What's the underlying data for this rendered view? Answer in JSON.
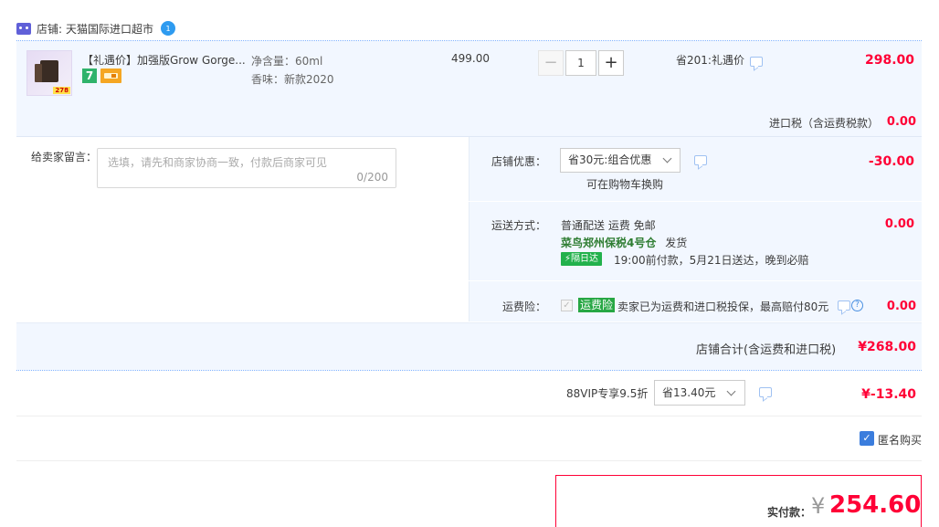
{
  "shop": {
    "label": "店铺:",
    "name": "天猫国际进口超市",
    "badge": "1"
  },
  "item": {
    "title": "【礼遇价】加强版Grow Gorge...",
    "thumb_price": "278",
    "sku": [
      {
        "label": "净含量：",
        "value": "60ml"
      },
      {
        "label": "香味：",
        "value": "新款2020"
      }
    ],
    "unit_price": "499.00",
    "quantity": "1",
    "promo": "省201:礼遇价",
    "subtotal": "298.00",
    "badge_7": "7"
  },
  "tax": {
    "label": "进口税（含运费税款）",
    "value": "0.00"
  },
  "message": {
    "label": "给卖家留言：",
    "placeholder": "选填，请先和商家协商一致，付款后商家可见",
    "counter": "0/200"
  },
  "discount": {
    "label": "店铺优惠：",
    "selected": "省30元:组合优惠",
    "hint": "可在购物车换购",
    "value": "-30.00"
  },
  "shipping": {
    "label": "运送方式：",
    "method": "普通配送 运费 免邮",
    "warehouse": "菜鸟郑州保税4号仓",
    "ship_word": "发货",
    "next_day": "隔日达",
    "eta": "19:00前付款，5月21日送达，晚到必赔",
    "value": "0.00"
  },
  "insurance": {
    "label": "运费险：",
    "tag": "运费险",
    "desc": "卖家已为运费和进口税投保，最高赔付80元",
    "value": "0.00"
  },
  "shop_total": {
    "label": "店铺合计(含运费和进口税)",
    "value": "¥268.00"
  },
  "vip": {
    "label": "88VIP专享9.5折",
    "selected": "省13.40元",
    "value": "¥-13.40"
  },
  "anonymous": {
    "label": "匿名购买",
    "checked": true
  },
  "pay": {
    "label": "实付款：",
    "currency": "¥",
    "value": "254.60"
  },
  "colors": {
    "accent_red": "#ff0036",
    "bg_blue": "#f2f7ff",
    "border_blue": "#80b2ff"
  }
}
